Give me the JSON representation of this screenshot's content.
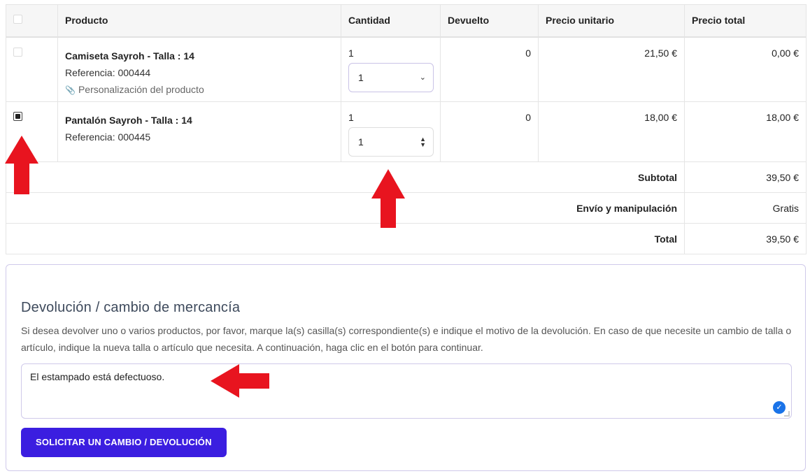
{
  "table": {
    "headers": {
      "product": "Producto",
      "quantity": "Cantidad",
      "returned": "Devuelto",
      "unit_price": "Precio unitario",
      "total_price": "Precio total"
    },
    "rows": [
      {
        "checked": false,
        "name": "Camiseta Sayroh - Talla : 14",
        "reference": "Referencia: 000444",
        "customization": "Personalización del producto",
        "quantity": "1",
        "select_value": "1",
        "returned": "0",
        "unit_price": "21,50 €",
        "total_price": "0,00 €"
      },
      {
        "checked": true,
        "name": "Pantalón Sayroh - Talla : 14",
        "reference": "Referencia: 000445",
        "quantity": "1",
        "select_value": "1",
        "returned": "0",
        "unit_price": "18,00 €",
        "total_price": "18,00 €"
      }
    ],
    "summary": [
      {
        "label": "Subtotal",
        "value": "39,50 €"
      },
      {
        "label": "Envío y manipulación",
        "value": "Gratis"
      },
      {
        "label": "Total",
        "value": "39,50 €"
      }
    ]
  },
  "return_form": {
    "title": "Devolución / cambio de mercancía",
    "description": "Si desea devolver uno o varios productos, por favor, marque la(s) casilla(s) correspondiente(s) e indique el motivo de la devolución. En caso de que necesite un cambio de talla o artículo, indique la nueva talla o artículo que necesita. A continuación, haga clic en el botón para continuar.",
    "message_value": "El estampado está defectuoso.",
    "submit_label": "SOLICITAR UN CAMBIO / DEVOLUCIÓN"
  },
  "colors": {
    "accent": "#3b1ee0",
    "annotation_arrow": "#e8141f",
    "border_focus": "#cfc9ea"
  },
  "icons": {
    "attachment": "paperclip-icon",
    "select_caret": "chevron-down-icon",
    "number_spinner": "spinner-icon",
    "grammar": "check-badge-icon"
  }
}
